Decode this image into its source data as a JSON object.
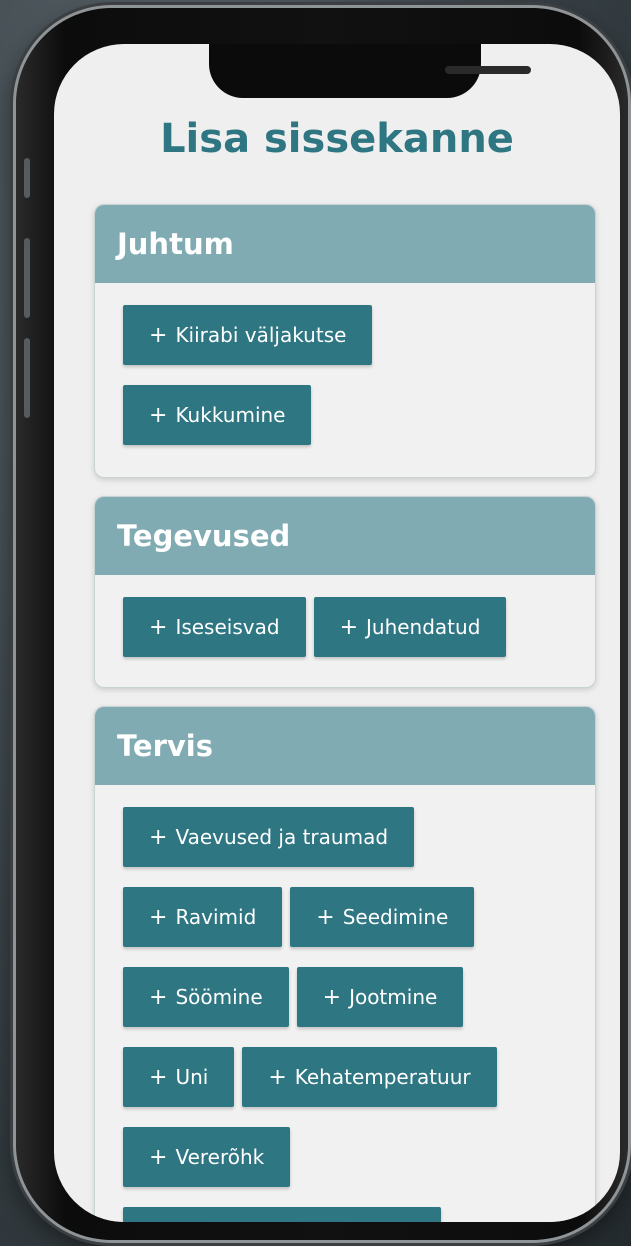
{
  "page": {
    "title": "Lisa sissekanne"
  },
  "colors": {
    "accent": "#2f7683",
    "header": "#80abb2",
    "background": "#efefef"
  },
  "sections": [
    {
      "title": "Juhtum",
      "rows": [
        [
          {
            "label": "Kiirabi väljakutse",
            "icon": "plus-icon"
          }
        ],
        [
          {
            "label": "Kukkumine",
            "icon": "plus-icon"
          }
        ]
      ]
    },
    {
      "title": "Tegevused",
      "rows": [
        [
          {
            "label": "Iseseisvad",
            "icon": "plus-icon"
          },
          {
            "label": "Juhendatud",
            "icon": "plus-icon"
          }
        ]
      ]
    },
    {
      "title": "Tervis",
      "rows": [
        [
          {
            "label": "Vaevused ja traumad",
            "icon": "plus-icon"
          }
        ],
        [
          {
            "label": "Ravimid",
            "icon": "plus-icon"
          },
          {
            "label": "Seedimine",
            "icon": "plus-icon"
          }
        ],
        [
          {
            "label": "Söömine",
            "icon": "plus-icon"
          },
          {
            "label": "Jootmine",
            "icon": "plus-icon"
          }
        ],
        [
          {
            "label": "Uni",
            "icon": "plus-icon"
          },
          {
            "label": "Kehatemperatuur",
            "icon": "plus-icon"
          }
        ],
        [
          {
            "label": "Vererõhk",
            "icon": "plus-icon"
          }
        ]
      ]
    }
  ],
  "plus_glyph": "+"
}
